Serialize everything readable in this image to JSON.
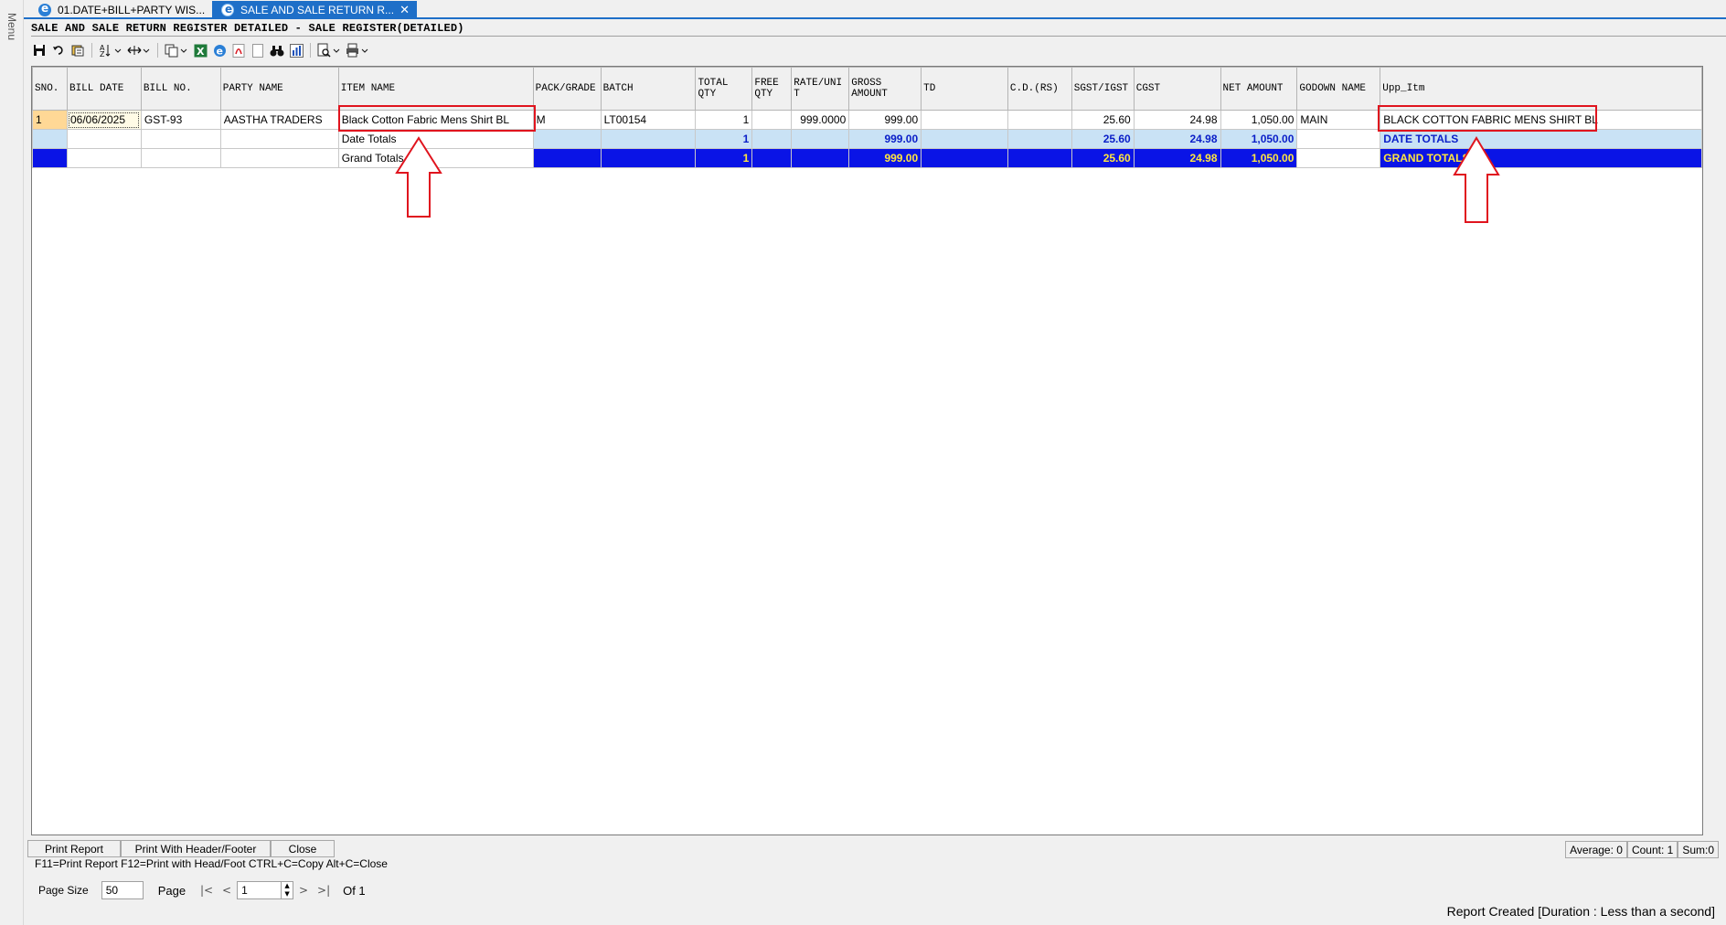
{
  "side_menu": {
    "label": "Menu"
  },
  "tabs": [
    {
      "label": "01.DATE+BILL+PARTY WIS..."
    },
    {
      "label": "SALE AND SALE RETURN R...",
      "close": "✕"
    }
  ],
  "report_title": "SALE AND SALE RETURN REGISTER DETAILED - SALE REGISTER(DETAILED)",
  "toolbar": {
    "icons": [
      "save-icon",
      "undo-icon",
      "filter-icon",
      "sort-icon",
      "column-width-icon",
      "copy-icon",
      "excel-icon",
      "ie-icon",
      "pdf-icon",
      "blank-page-icon",
      "find-icon",
      "chart-icon",
      "print-preview-icon",
      "print-icon"
    ]
  },
  "grid": {
    "columns": [
      {
        "label": "SNO."
      },
      {
        "label": "BILL DATE"
      },
      {
        "label": "BILL NO."
      },
      {
        "label": "PARTY NAME"
      },
      {
        "label": "ITEM NAME"
      },
      {
        "label": "PACK/GRADE"
      },
      {
        "label": "BATCH"
      },
      {
        "label": "TOTAL\nQTY"
      },
      {
        "label": "FREE\nQTY"
      },
      {
        "label": "RATE/UNI\nT"
      },
      {
        "label": "GROSS\nAMOUNT"
      },
      {
        "label": "TD"
      },
      {
        "label": "C.D.(RS)"
      },
      {
        "label": "SGST/IGST"
      },
      {
        "label": "CGST"
      },
      {
        "label": "NET AMOUNT"
      },
      {
        "label": "GODOWN NAME"
      },
      {
        "label": "Upp_Itm"
      }
    ],
    "data_row": {
      "sno": "1",
      "bill_date": "06/06/2025",
      "bill_no": "GST-93",
      "party_name": "AASTHA TRADERS",
      "item_name": "Black Cotton Fabric Mens Shirt BL",
      "pack_grade": "M",
      "batch": "LT00154",
      "total_qty": "1",
      "free_qty": "",
      "rate_unit": "999.0000",
      "gross_amount": "999.00",
      "td": "",
      "cd": "",
      "sgst_igst": "25.60",
      "cgst": "24.98",
      "net_amount": "1,050.00",
      "godown": "MAIN",
      "upp_itm": "BLACK COTTON FABRIC MENS SHIRT BL"
    },
    "date_totals": {
      "label": "Date Totals",
      "total_qty": "1",
      "gross_amount": "999.00",
      "sgst_igst": "25.60",
      "cgst": "24.98",
      "net_amount": "1,050.00",
      "upp_itm": "DATE TOTALS"
    },
    "grand_totals": {
      "label": "Grand Totals",
      "total_qty": "1",
      "gross_amount": "999.00",
      "sgst_igst": "25.60",
      "cgst": "24.98",
      "net_amount": "1,050.00",
      "upp_itm": "GRAND TOTALS"
    }
  },
  "annotation_colors": {
    "highlight": "#e0141e"
  },
  "bottom_buttons": {
    "print_report": "Print Report",
    "print_header_footer": "Print With Header/Footer",
    "close": "Close"
  },
  "shortcut_hint": "F11=Print Report  F12=Print with Head/Foot  CTRL+C=Copy  Alt+C=Close",
  "stats": {
    "average": "Average: 0",
    "count": "Count: 1",
    "sum": "Sum:0"
  },
  "pager": {
    "page_size_label": "Page Size",
    "page_size": "50",
    "page_label": "Page",
    "page": "1",
    "of_label": "Of 1",
    "first": "|<",
    "prev": "<",
    "next": ">",
    "last": ">|"
  },
  "status": "Report Created [Duration : Less than a second]"
}
